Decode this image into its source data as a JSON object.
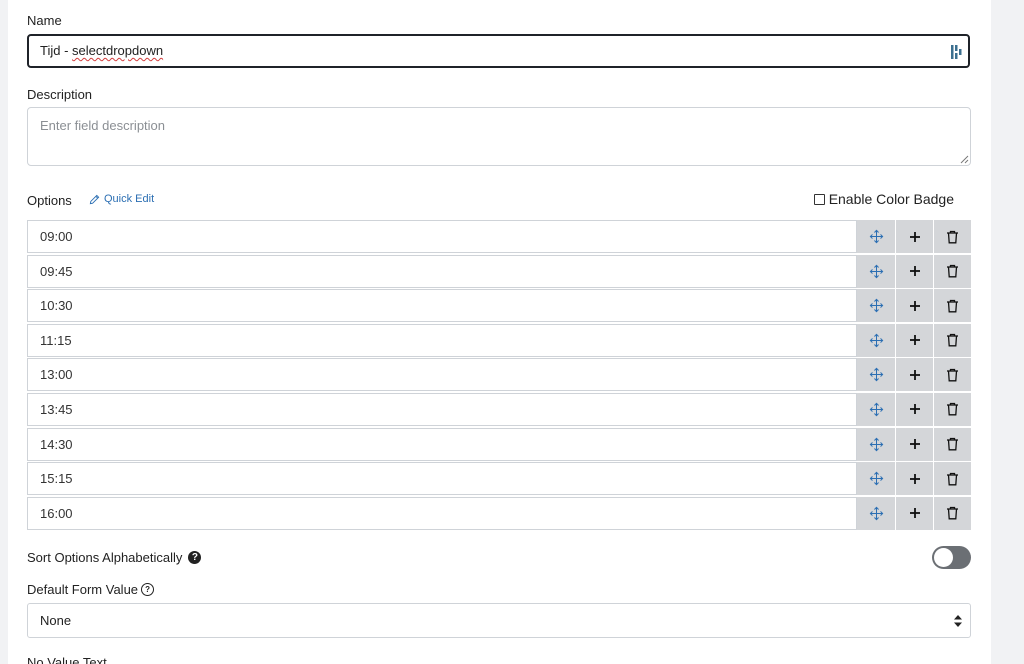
{
  "name_field": {
    "label": "Name",
    "value_prefix": "Tijd - ",
    "value_misspelled": "selectdropdown"
  },
  "description_field": {
    "label": "Description",
    "placeholder": "Enter field description"
  },
  "options_section": {
    "label": "Options",
    "quick_edit_label": "Quick Edit",
    "enable_color_badge_label": "Enable Color Badge",
    "enable_color_badge_checked": false,
    "options": [
      {
        "value": "09:00"
      },
      {
        "value": "09:45"
      },
      {
        "value": "10:30"
      },
      {
        "value": "11:15"
      },
      {
        "value": "13:00"
      },
      {
        "value": "13:45"
      },
      {
        "value": "14:30"
      },
      {
        "value": "15:15"
      },
      {
        "value": "16:00"
      }
    ]
  },
  "sort_options": {
    "label": "Sort Options Alphabetically",
    "help_glyph": "?",
    "enabled": false
  },
  "default_form_value": {
    "label": "Default Form Value",
    "help_glyph": "?",
    "selected": "None"
  },
  "no_value_text": {
    "label": "No Value Text"
  },
  "colors": {
    "accent_blue": "#2c6fb3",
    "button_gray": "#d4d6d9",
    "toggle_off": "#6b6f74"
  }
}
